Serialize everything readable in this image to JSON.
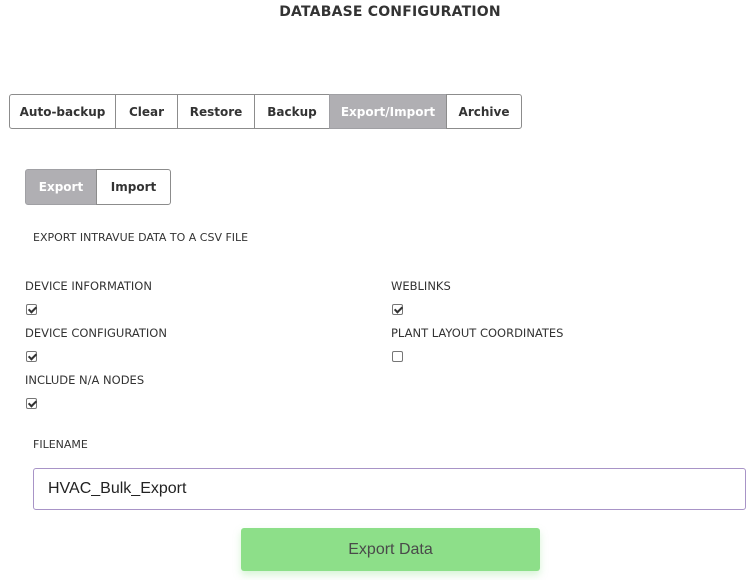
{
  "page": {
    "title": "DATABASE CONFIGURATION"
  },
  "tabs": [
    {
      "label": "Auto-backup",
      "active": false
    },
    {
      "label": "Clear",
      "active": false
    },
    {
      "label": "Restore",
      "active": false
    },
    {
      "label": "Backup",
      "active": false
    },
    {
      "label": "Export/Import",
      "active": true
    },
    {
      "label": "Archive",
      "active": false
    }
  ],
  "subtabs": [
    {
      "label": "Export",
      "active": true
    },
    {
      "label": "Import",
      "active": false
    }
  ],
  "export": {
    "heading": "EXPORT INTRAVUE DATA TO A CSV FILE",
    "options": {
      "device_information": {
        "label": "DEVICE INFORMATION",
        "checked": true
      },
      "weblinks": {
        "label": "WEBLINKS",
        "checked": true
      },
      "device_configuration": {
        "label": "DEVICE CONFIGURATION",
        "checked": true
      },
      "plant_layout_coordinates": {
        "label": "PLANT LAYOUT COORDINATES",
        "checked": false
      },
      "include_na_nodes": {
        "label": "INCLUDE N/A NODES",
        "checked": true
      }
    },
    "filename_label": "FILENAME",
    "filename_value": "HVAC_Bulk_Export",
    "button_label": "Export Data"
  },
  "colors": {
    "active_tab_bg": "#b0afb3",
    "export_button_bg": "#8ddf89",
    "input_border": "#a894c7"
  }
}
